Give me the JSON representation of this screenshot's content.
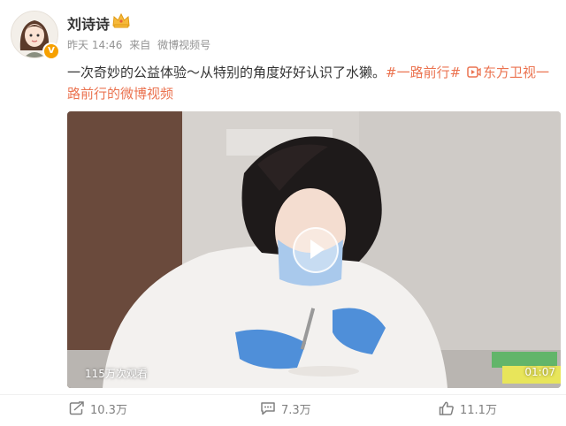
{
  "user": {
    "name": "刘诗诗",
    "verified_mark": "V",
    "time": "昨天 14:46",
    "source_prefix": "来自",
    "source": "微博视频号"
  },
  "post": {
    "text": "一次奇妙的公益体验～从特别的角度好好认识了水獭。",
    "tag": "#一路前行#",
    "link_icon": "video-icon",
    "link_text": "东方卫视一路前行的微博视频"
  },
  "video": {
    "views": "115万次观看",
    "duration": "01:07"
  },
  "actions": {
    "repost_count": "10.3万",
    "comment_count": "7.3万",
    "like_count": "11.1万"
  },
  "colors": {
    "accent": "#eb7350",
    "badge": "#f6a000",
    "muted": "#939393"
  }
}
